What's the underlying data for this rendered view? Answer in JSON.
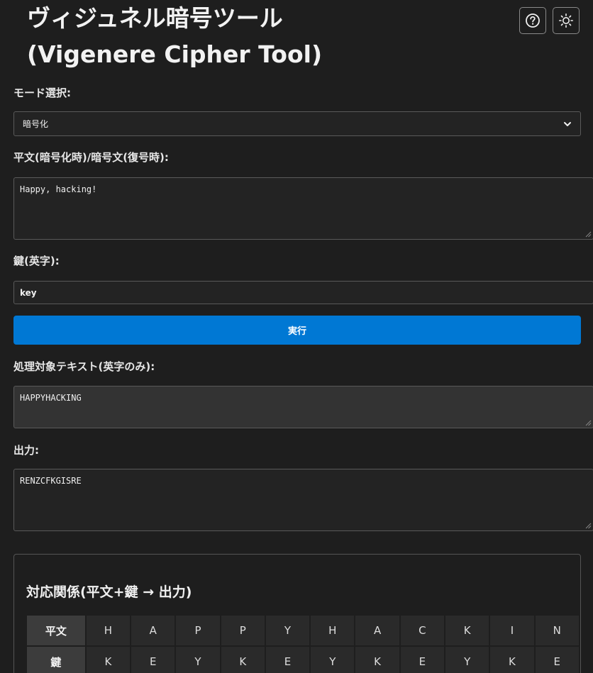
{
  "header": {
    "title_line1": "ヴィジュネル暗号ツール",
    "title_line2": "(Vigenere Cipher Tool)",
    "help_icon": "question-circle-icon",
    "theme_icon": "sun-icon"
  },
  "mode": {
    "label": "モード選択:",
    "selected": "暗号化"
  },
  "input_text": {
    "label": "平文(暗号化時)/暗号文(復号時):",
    "value": "Happy, hacking!"
  },
  "key": {
    "label": "鍵(英字):",
    "value": "key"
  },
  "run_button": {
    "label": "実行",
    "color": "#0078d4"
  },
  "processed": {
    "label": "処理対象テキスト(英字のみ):",
    "value": "HAPPYHACKING"
  },
  "output": {
    "label": "出力:",
    "value": "RENZCFKGISRE"
  },
  "mapping": {
    "title": "対応関係(平文+鍵 → 出力)",
    "rows": [
      {
        "header": "平文",
        "cells": [
          "H",
          "A",
          "P",
          "P",
          "Y",
          "H",
          "A",
          "C",
          "K",
          "I",
          "N"
        ]
      },
      {
        "header": "鍵",
        "cells": [
          "K",
          "E",
          "Y",
          "K",
          "E",
          "Y",
          "K",
          "E",
          "Y",
          "K",
          "E"
        ]
      }
    ]
  }
}
